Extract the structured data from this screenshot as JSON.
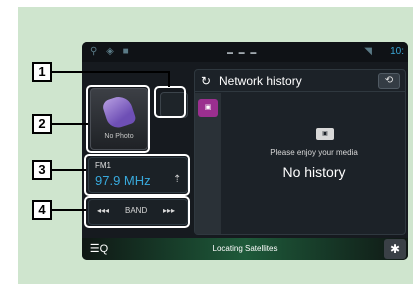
{
  "statusbar": {
    "icons": "⚲ ◈ ■",
    "wifi": "◥",
    "time": "10:",
    "page_dots": "▬ ▬ ▬"
  },
  "source": {
    "artwork_text": "No Photo",
    "band": "FM1",
    "frequency": "97.9 MHz",
    "tune_icon": "⇡",
    "seek_back": "◂◂◂",
    "band_button": "BAND",
    "seek_forward": "▸▸▸"
  },
  "panel": {
    "title": "Network history",
    "refresh_icon": "↻",
    "sync_icon": "⟲",
    "tab_icon": "▣",
    "logo_icon": "▣",
    "message": "Please enjoy your media",
    "empty_text": "No history"
  },
  "bottombar": {
    "search_icon": "☰Q",
    "status": "Locating Satellites",
    "gear_icon": "✱"
  },
  "callouts": [
    "1",
    "2",
    "3",
    "4"
  ],
  "colors": {
    "frame_bg": "#cfe5ce",
    "accent": "#38a9dc",
    "youtube_tab": "#9b2f8f"
  }
}
